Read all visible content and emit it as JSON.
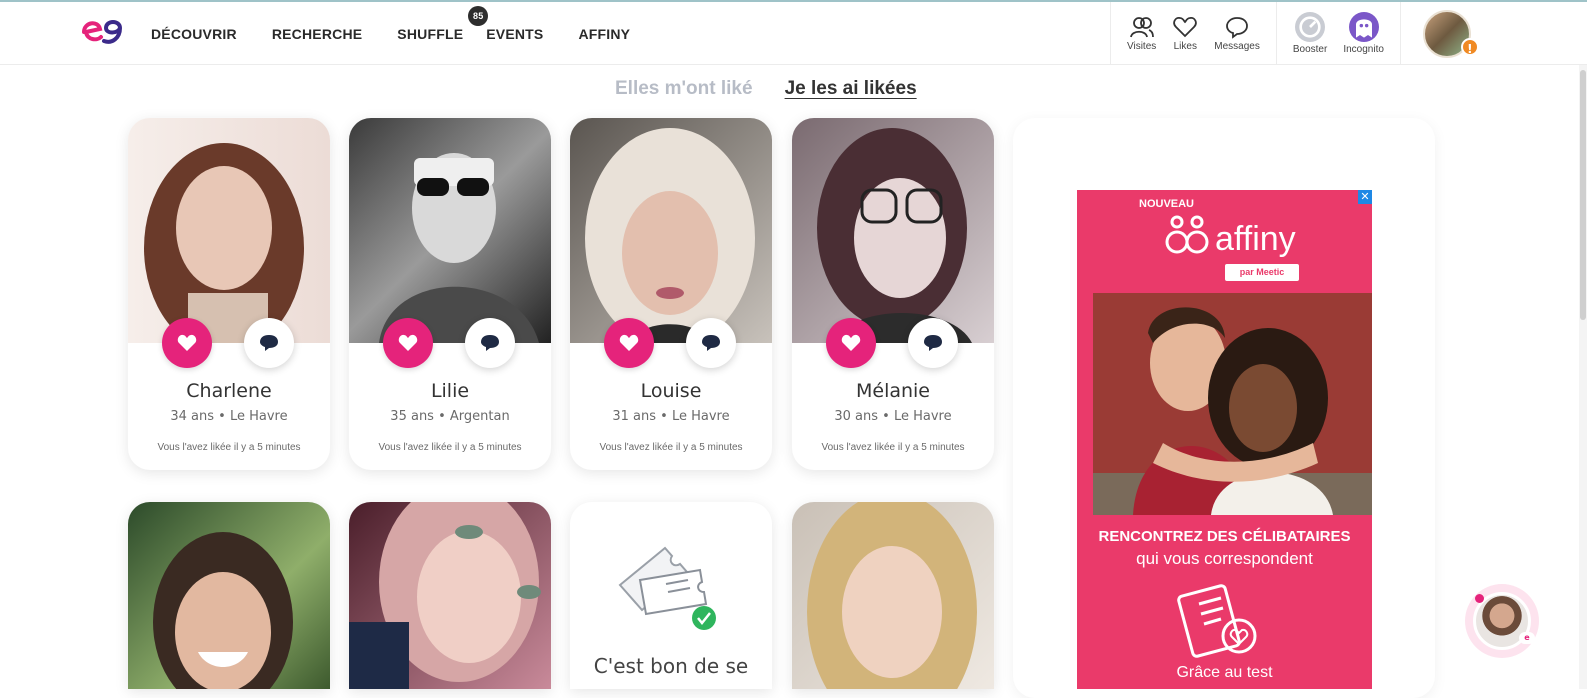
{
  "header": {
    "nav": [
      {
        "label": "DÉCOUVRIR"
      },
      {
        "label": "RECHERCHE"
      },
      {
        "label": "SHUFFLE",
        "badge": "85"
      },
      {
        "label": "EVENTS"
      },
      {
        "label": "AFFINY"
      }
    ],
    "actions": [
      {
        "label": "Visites",
        "icon": "visitors-icon"
      },
      {
        "label": "Likes",
        "icon": "heart-icon"
      },
      {
        "label": "Messages",
        "icon": "chat-icon"
      }
    ],
    "extras": [
      {
        "label": "Booster",
        "icon": "booster-icon"
      },
      {
        "label": "Incognito",
        "icon": "ghost-icon"
      }
    ],
    "avatar_warning": "!"
  },
  "tabs": [
    {
      "label": "Elles m'ont liké",
      "active": false
    },
    {
      "label": "Je les ai likées",
      "active": true
    }
  ],
  "profiles_row1": [
    {
      "name": "Charlene",
      "meta": "34 ans • Le Havre",
      "when": "Vous l'avez likée il y a 5 minutes"
    },
    {
      "name": "Lilie",
      "meta": "35 ans • Argentan",
      "when": "Vous l'avez likée il y a 5 minutes"
    },
    {
      "name": "Louise",
      "meta": "31 ans • Le Havre",
      "when": "Vous l'avez likée il y a 5 minutes"
    },
    {
      "name": "Mélanie",
      "meta": "30 ans • Le Havre",
      "when": "Vous l'avez likée il y a 5 minutes"
    }
  ],
  "promo_card": {
    "text": "C'est bon de se"
  },
  "ad": {
    "close": "✕",
    "nouveau": "NOUVEAU",
    "brand": "affiny",
    "par": "par Meetic",
    "headline": "RENCONTREZ DES CÉLIBATAIRES",
    "subline": "qui vous correspondent",
    "footer": "Grâce au test"
  },
  "colors": {
    "accent": "#e5237b",
    "ad_bg": "#ea3a6a",
    "text": "#2b2b2b"
  }
}
